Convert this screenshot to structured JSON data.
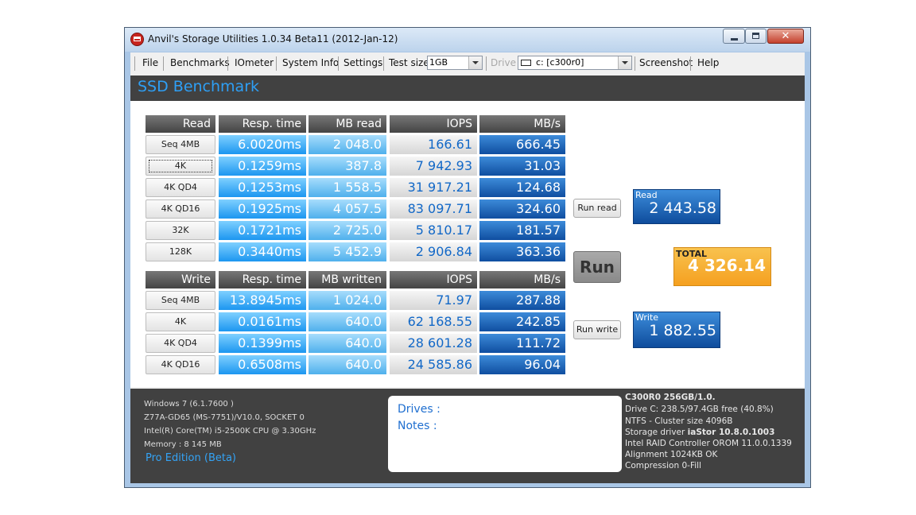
{
  "window": {
    "title": "Anvil's Storage Utilities 1.0.34 Beta11 (2012-Jan-12)"
  },
  "menu": {
    "file": "File",
    "benchmarks": "Benchmarks",
    "iometer": "IOmeter",
    "system_info": "System Info",
    "settings": "Settings",
    "test_size_label": "Test size",
    "test_size_value": "1GB",
    "drive_label": "Drive",
    "drive_value": "c: [c300r0]",
    "screenshot": "Screenshot",
    "help": "Help"
  },
  "header": {
    "title": "SSD Benchmark"
  },
  "read_section": {
    "headers": [
      "Read",
      "Resp. time",
      "MB read",
      "IOPS",
      "MB/s"
    ],
    "rows": [
      {
        "label": "Seq 4MB",
        "resp": "6.0020ms",
        "mb": "2 048.0",
        "iops": "166.61",
        "mbs": "666.45"
      },
      {
        "label": "4K",
        "resp": "0.1259ms",
        "mb": "387.8",
        "iops": "7 942.93",
        "mbs": "31.03"
      },
      {
        "label": "4K QD4",
        "resp": "0.1253ms",
        "mb": "1 558.5",
        "iops": "31 917.21",
        "mbs": "124.68"
      },
      {
        "label": "4K QD16",
        "resp": "0.1925ms",
        "mb": "4 057.5",
        "iops": "83 097.71",
        "mbs": "324.60"
      },
      {
        "label": "32K",
        "resp": "0.1721ms",
        "mb": "2 725.0",
        "iops": "5 810.17",
        "mbs": "181.57"
      },
      {
        "label": "128K",
        "resp": "0.3440ms",
        "mb": "5 452.9",
        "iops": "2 906.84",
        "mbs": "363.36"
      }
    ]
  },
  "write_section": {
    "headers": [
      "Write",
      "Resp. time",
      "MB written",
      "IOPS",
      "MB/s"
    ],
    "rows": [
      {
        "label": "Seq 4MB",
        "resp": "13.8945ms",
        "mb": "1 024.0",
        "iops": "71.97",
        "mbs": "287.88"
      },
      {
        "label": "4K",
        "resp": "0.0161ms",
        "mb": "640.0",
        "iops": "62 168.55",
        "mbs": "242.85"
      },
      {
        "label": "4K QD4",
        "resp": "0.1399ms",
        "mb": "640.0",
        "iops": "28 601.28",
        "mbs": "111.72"
      },
      {
        "label": "4K QD16",
        "resp": "0.6508ms",
        "mb": "640.0",
        "iops": "24 585.86",
        "mbs": "96.04"
      }
    ]
  },
  "buttons": {
    "run_read": "Run read",
    "run": "Run",
    "run_write": "Run write"
  },
  "scores": {
    "read_label": "Read",
    "read_value": "2 443.58",
    "total_label": "TOTAL",
    "total_value": "4 326.14",
    "write_label": "Write",
    "write_value": "1 882.55"
  },
  "system": {
    "os": "Windows 7 (6.1.7600 )",
    "board": "Z77A-GD65 (MS-7751)/V10.0, SOCKET 0",
    "cpu": "Intel(R) Core(TM) i5-2500K CPU @ 3.30GHz",
    "memory": "Memory : 8 145 MB",
    "edition": "Pro Edition (Beta)"
  },
  "notes": {
    "drives_label": "Drives :",
    "notes_label": "Notes :"
  },
  "drive_info": {
    "model": "C300R0 256GB/1.0.",
    "space": "Drive C: 238.5/97.4GB free (40.8%)",
    "fs": "NTFS - Cluster size 4096B",
    "driver_label": "Storage driver",
    "driver_name": "iaStor 10.8.0.1003",
    "raid": "Intel RAID Controller OROM 11.0.0.1339",
    "alignment": "Alignment 1024KB OK",
    "compression": "Compression 0-Fill"
  },
  "colors": {
    "header_bg": "#414141",
    "accent_blue": "#2e9ff5",
    "mbs_blue": "#1a5fb4",
    "iops_text": "#1268c7",
    "total_orange": "#f5a623"
  },
  "icons": {
    "app": "anvil-app-icon",
    "drive": "hard-drive-icon"
  }
}
